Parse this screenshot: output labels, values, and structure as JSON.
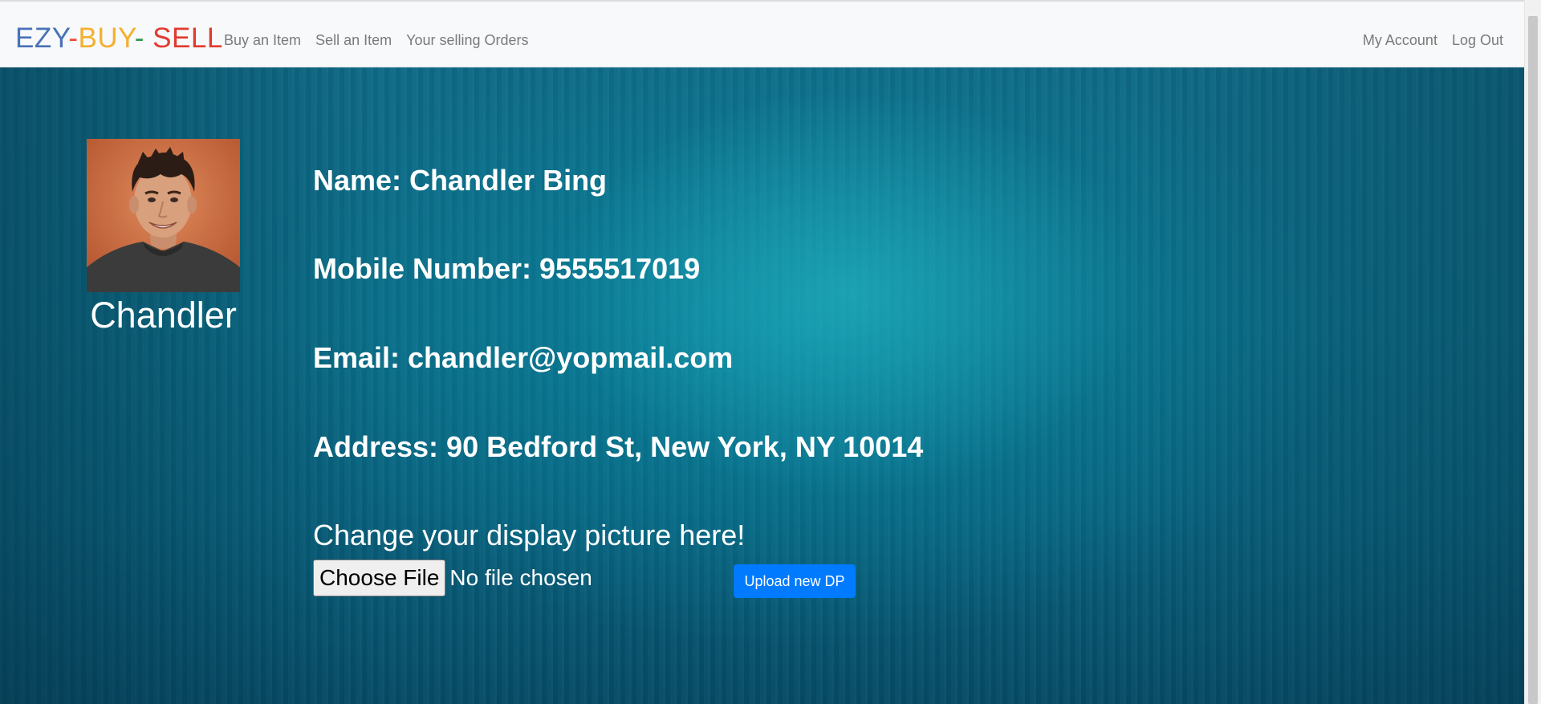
{
  "navbar": {
    "brand": {
      "part1": "EZY",
      "sep1": "-",
      "part2": "BUY",
      "sep2": "-",
      "part3": " SELL",
      "colors": {
        "part1": "#4a72b8",
        "sep1": "#e94f3e",
        "part2": "#f4b02f",
        "sep2": "#2e9b4e",
        "part3": "#e23b2e"
      }
    },
    "left_links": [
      "Buy an Item",
      "Sell an Item",
      "Your selling Orders"
    ],
    "right_links": [
      "My Account",
      "Log Out"
    ]
  },
  "profile": {
    "avatar_icon": "user-photo",
    "display_name": "Chandler",
    "name_line": "Name: Chandler Bing",
    "mobile_line": "Mobile Number: 9555517019",
    "email_line": "Email: chandler@yopmail.com",
    "address_line": "Address: 90 Bedford St, New York, NY 10014"
  },
  "upload": {
    "heading": "Change your display picture here!",
    "choose_file_label": "Choose File",
    "file_status": "No file chosen",
    "upload_button_label": "Upload new DP",
    "accent_color": "#007bff"
  }
}
